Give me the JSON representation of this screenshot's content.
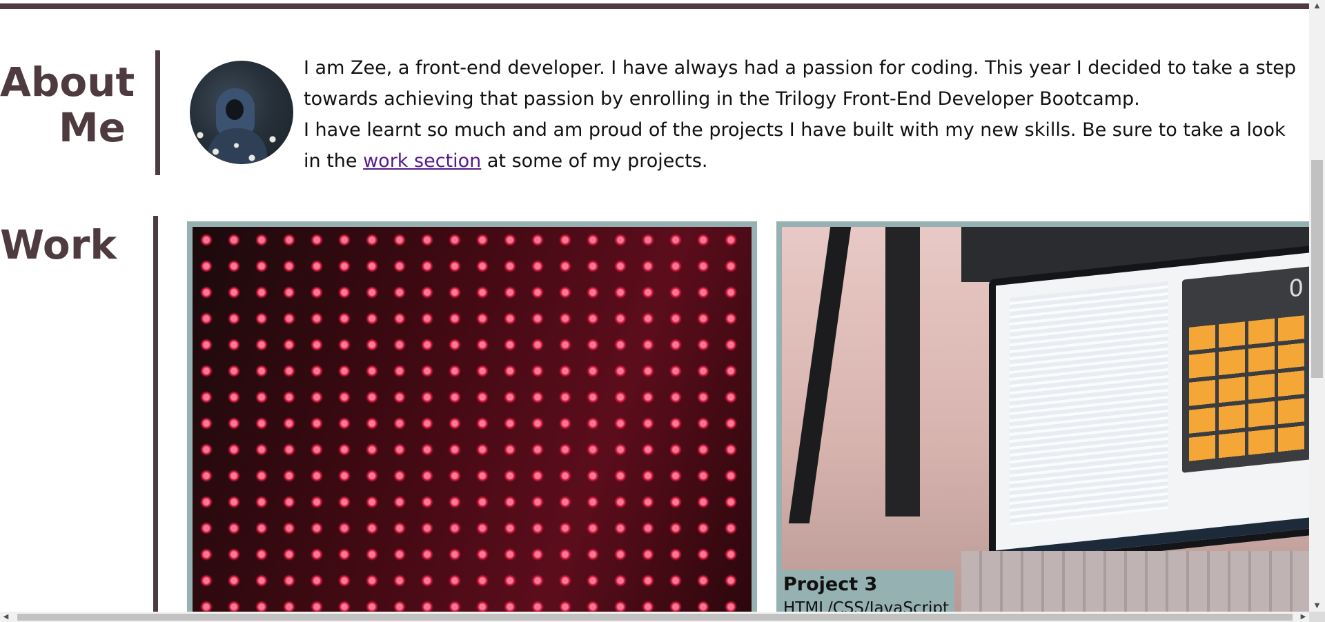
{
  "about": {
    "title": "About Me",
    "intro": "I am Zee, a front-end developer. I have always had a passion for coding. This year I decided to take a step towards achieving that passion by enrolling in the Trilogy Front-End Developer Bootcamp.",
    "text_before_link": "I have learnt so much and am proud of the projects I have built with my new skills. Be sure to take a look in the ",
    "link_text": "work section",
    "text_after_link": " at some of my projects.",
    "avatar_icon": "profile-photo"
  },
  "work": {
    "title": "Work",
    "projects": [
      {
        "image": "red-led-wall"
      },
      {
        "image": "laptop-calculator-app",
        "title": "Project 3",
        "tech": "HTML/CSS/JavaScript",
        "calc_display": "0"
      }
    ]
  },
  "colors": {
    "accent": "#4e3b40",
    "card_border": "#96b1b2",
    "link": "#551a8b"
  },
  "scrollbars": {
    "up_icon": "▲",
    "down_icon": "▼",
    "left_icon": "◀",
    "right_icon": "▶"
  }
}
